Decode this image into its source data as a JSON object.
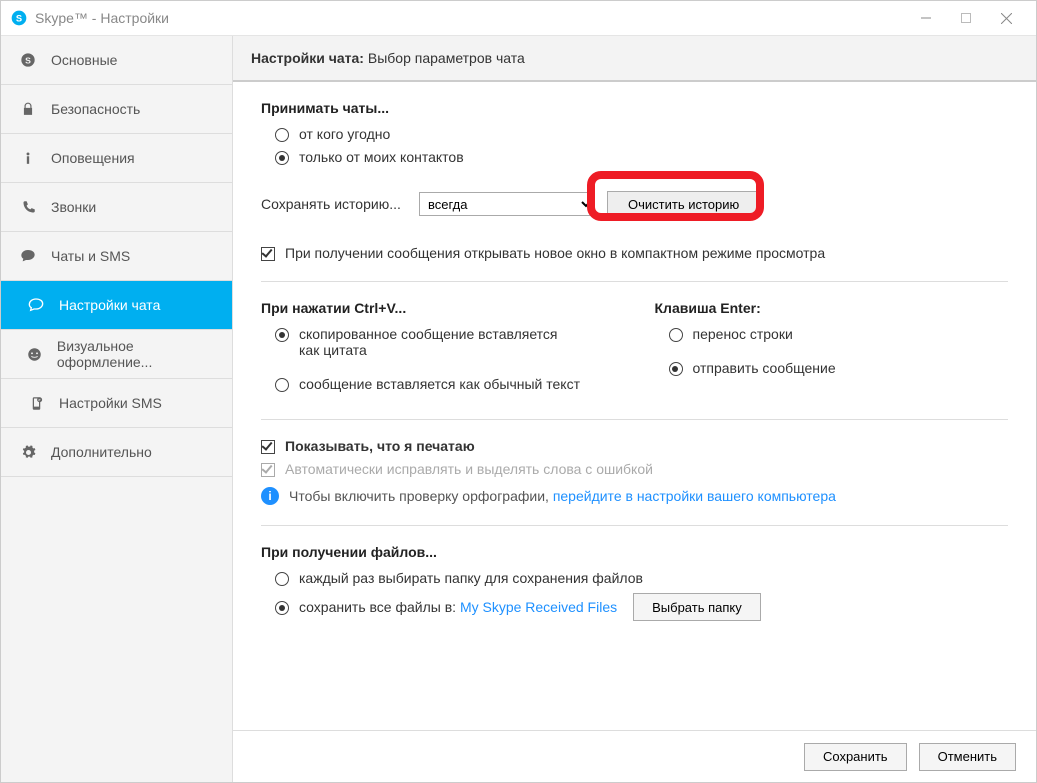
{
  "window_title": "Skype™ - Настройки",
  "sidebar": {
    "items": [
      {
        "label": "Основные"
      },
      {
        "label": "Безопасность"
      },
      {
        "label": "Оповещения"
      },
      {
        "label": "Звонки"
      },
      {
        "label": "Чаты и SMS"
      },
      {
        "label": "Настройки чата"
      },
      {
        "label": "Визуальное оформление..."
      },
      {
        "label": "Настройки SMS"
      },
      {
        "label": "Дополнительно"
      }
    ]
  },
  "header": {
    "title_bold": "Настройки чата:",
    "title_rest": " Выбор параметров чата"
  },
  "accept_chats": {
    "title": "Принимать чаты...",
    "opt_anyone": "от кого угодно",
    "opt_contacts": "только от моих контактов"
  },
  "history": {
    "label": "Сохранять историю...",
    "selected": "всегда",
    "clear_btn": "Очистить историю"
  },
  "open_new_window": "При получении сообщения открывать новое окно в компактном режиме просмотра",
  "ctrlv": {
    "title": "При нажатии Ctrl+V...",
    "opt_quote": "скопированное сообщение вставляется как цитата",
    "opt_plain": "сообщение вставляется как обычный текст"
  },
  "enter": {
    "title": "Клавиша Enter:",
    "opt_newline": "перенос строки",
    "opt_send": "отправить сообщение"
  },
  "typing": {
    "show_typing": "Показывать, что я печатаю",
    "autocorrect": "Автоматически исправлять и выделять слова с ошибкой",
    "info_text": "Чтобы включить проверку орфографии, ",
    "info_link": "перейдите в настройки вашего компьютера"
  },
  "files": {
    "title": "При получении файлов...",
    "opt_ask": "каждый раз выбирать папку для сохранения файлов",
    "opt_save_prefix": "сохранить все файлы в: ",
    "opt_save_link": "My Skype Received Files",
    "choose_btn": "Выбрать папку"
  },
  "footer": {
    "save": "Сохранить",
    "cancel": "Отменить"
  }
}
